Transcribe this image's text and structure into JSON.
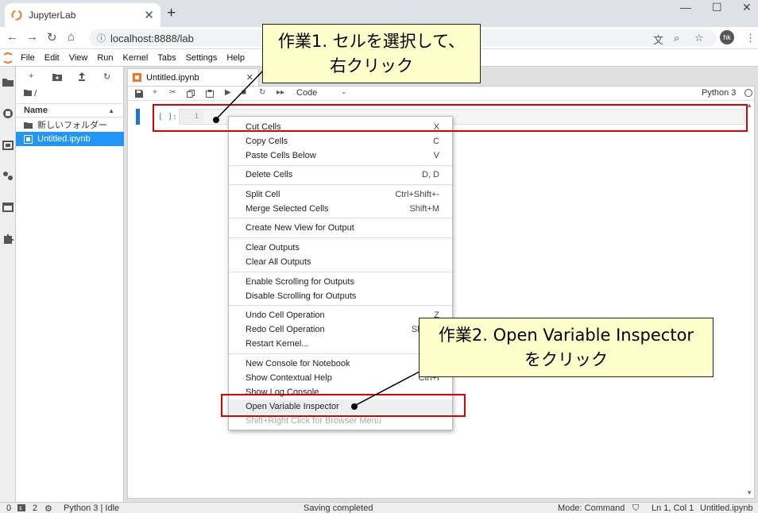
{
  "browser": {
    "tab_title": "JupyterLab",
    "tab_close": "✕",
    "new_tab": "+",
    "url": "localhost:8888/lab",
    "profile_initials": "hk",
    "win_minimize": "—",
    "win_maximize": "☐",
    "win_close": "✕"
  },
  "menubar": {
    "items": [
      "File",
      "Edit",
      "View",
      "Run",
      "Kernel",
      "Tabs",
      "Settings",
      "Help"
    ]
  },
  "filebrowser": {
    "path": "/",
    "column_name": "Name",
    "sort_arrow": "▲",
    "items": [
      {
        "name": "新しいフォルダー",
        "type": "folder",
        "selected": false
      },
      {
        "name": "Untitled.ipynb",
        "type": "notebook",
        "selected": true
      }
    ]
  },
  "notebook": {
    "tab_title": "Untitled.ipynb",
    "tab_close": "✕",
    "cell_type": "Code",
    "kernel_name": "Python 3",
    "prompt": "[ ]:",
    "line_number": "1"
  },
  "context_menu": {
    "items": [
      {
        "label": "Cut Cells",
        "shortcut": "X",
        "disabled": false
      },
      {
        "label": "Copy Cells",
        "shortcut": "C",
        "disabled": false
      },
      {
        "label": "Paste Cells Below",
        "shortcut": "V",
        "disabled": false
      },
      {
        "label": "Delete Cells",
        "shortcut": "D, D",
        "disabled": false
      },
      {
        "label": "Split Cell",
        "shortcut": "Ctrl+Shift+-",
        "disabled": false
      },
      {
        "label": "Merge Selected Cells",
        "shortcut": "Shift+M",
        "disabled": false
      },
      {
        "label": "Create New View for Output",
        "shortcut": "",
        "disabled": false
      },
      {
        "label": "Clear Outputs",
        "shortcut": "",
        "disabled": false
      },
      {
        "label": "Clear All Outputs",
        "shortcut": "",
        "disabled": false
      },
      {
        "label": "Enable Scrolling for Outputs",
        "shortcut": "",
        "disabled": false
      },
      {
        "label": "Disable Scrolling for Outputs",
        "shortcut": "",
        "disabled": false
      },
      {
        "label": "Undo Cell Operation",
        "shortcut": "Z",
        "disabled": false
      },
      {
        "label": "Redo Cell Operation",
        "shortcut": "Shift+Z",
        "disabled": false
      },
      {
        "label": "Restart Kernel...",
        "shortcut": "",
        "disabled": false
      },
      {
        "label": "New Console for Notebook",
        "shortcut": "",
        "disabled": false
      },
      {
        "label": "Show Contextual Help",
        "shortcut": "Ctrl+I",
        "disabled": false
      },
      {
        "label": "Show Log Console",
        "shortcut": "",
        "disabled": false
      },
      {
        "label": "Open Variable Inspector",
        "shortcut": "",
        "disabled": false,
        "highlighted": true
      },
      {
        "label": "Shift+Right Click for Browser Menu",
        "shortcut": "",
        "disabled": true
      }
    ]
  },
  "statusbar": {
    "terminals": "0",
    "kernels": "2",
    "kernel_status": "Python 3 | Idle",
    "message": "Saving completed",
    "mode": "Mode: Command",
    "position": "Ln 1, Col 1",
    "filename": "Untitled.ipynb"
  },
  "annotations": {
    "step1_line1": "作業1. セルを選択して、",
    "step1_line2": "右クリック",
    "step2_line1": "作業2. Open Variable Inspector",
    "step2_line2": "をクリック"
  },
  "colors": {
    "accent": "#2196f3",
    "annotation_red": "#e00000",
    "callout_bg": "#ffffcc",
    "jupyter_orange": "#f37726"
  },
  "icons": {
    "back": "back-arrow-icon",
    "forward": "forward-arrow-icon",
    "reload": "reload-icon",
    "home": "home-icon",
    "info": "info-icon",
    "translate": "translate-icon",
    "zoom": "zoom-icon",
    "bookmark": "star-icon",
    "menu": "kebab-menu-icon"
  }
}
